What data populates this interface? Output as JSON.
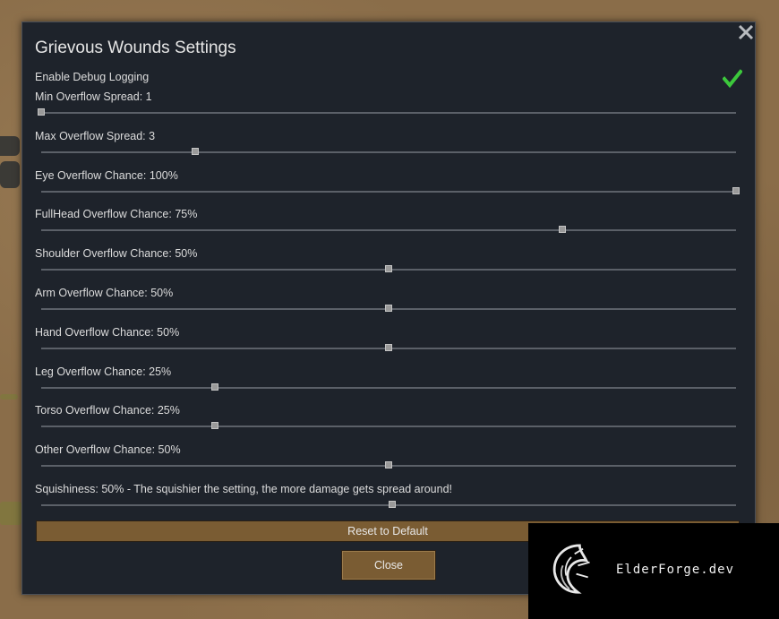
{
  "dialog": {
    "title": "Grievous Wounds Settings",
    "close_icon": "close-icon"
  },
  "debug": {
    "label": "Enable Debug Logging",
    "checked": true,
    "check_icon": "checkmark-icon",
    "check_color": "#3cc83c"
  },
  "sliders": [
    {
      "label": "Min Overflow Spread: 1",
      "fraction": 0.0
    },
    {
      "label": "Max Overflow Spread: 3",
      "fraction": 0.222
    },
    {
      "label": "Eye Overflow Chance: 100%",
      "fraction": 1.0
    },
    {
      "label": "FullHead Overflow Chance: 75%",
      "fraction": 0.75
    },
    {
      "label": "Shoulder Overflow Chance: 50%",
      "fraction": 0.5
    },
    {
      "label": "Arm Overflow Chance: 50%",
      "fraction": 0.5
    },
    {
      "label": "Hand Overflow Chance: 50%",
      "fraction": 0.5
    },
    {
      "label": "Leg Overflow Chance: 25%",
      "fraction": 0.25
    },
    {
      "label": "Torso Overflow Chance: 25%",
      "fraction": 0.25
    },
    {
      "label": "Other Overflow Chance: 50%",
      "fraction": 0.5
    },
    {
      "label": "Squishiness: 50% - The squishier the setting, the more damage gets spread around!",
      "fraction": 0.505
    }
  ],
  "buttons": {
    "reset_label": "Reset to Default",
    "close_label": "Close"
  },
  "colors": {
    "button_brown": "#7a5c33",
    "panel_bg": "#1e232b"
  },
  "watermark": {
    "text": "ElderForge.dev",
    "logo_icon": "dragon-logo-icon"
  }
}
